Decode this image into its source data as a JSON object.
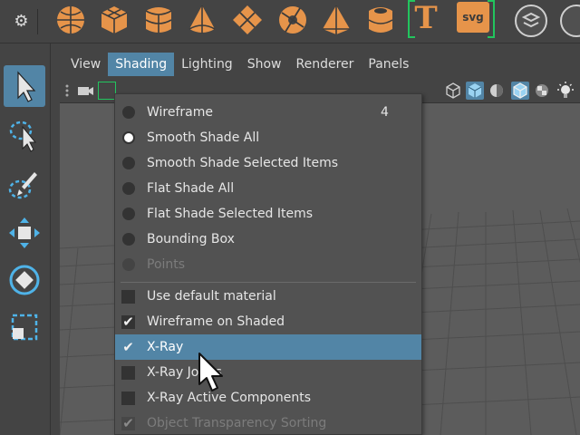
{
  "menubar": {
    "items": [
      "View",
      "Shading",
      "Lighting",
      "Show",
      "Renderer",
      "Panels"
    ]
  },
  "shelf": {
    "text_tool": "T",
    "svg_tool": "svg"
  },
  "shading_menu": {
    "items": [
      {
        "label": "Wireframe",
        "shortcut": "4"
      },
      {
        "label": "Smooth Shade All"
      },
      {
        "label": "Smooth Shade Selected Items"
      },
      {
        "label": "Flat Shade All"
      },
      {
        "label": "Flat Shade Selected Items"
      },
      {
        "label": "Bounding Box"
      },
      {
        "label": "Points"
      },
      {
        "label": "Use default material"
      },
      {
        "label": "Wireframe on Shaded"
      },
      {
        "label": "X-Ray"
      },
      {
        "label": "X-Ray Joints"
      },
      {
        "label": "X-Ray Active Components"
      },
      {
        "label": "Object Transparency Sorting"
      }
    ]
  },
  "colors": {
    "accent": "#5285a6",
    "shelf_icon": "#e6944a",
    "selection_bracket": "#22c55e"
  }
}
